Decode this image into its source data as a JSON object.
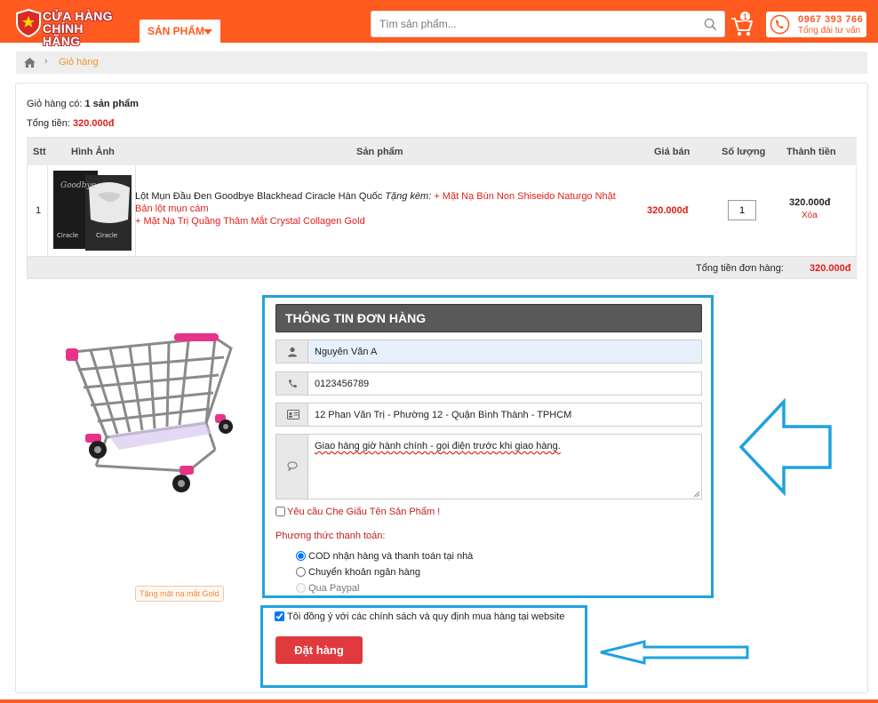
{
  "header": {
    "logo_line1": "CỬA HÀNG",
    "logo_line2": "CHÍNH HÃNG",
    "menu_label": "SẢN PHẨM",
    "search_placeholder": "Tìm sản phẩm...",
    "cart_count": "1",
    "hotline_number": "0967 393 766",
    "hotline_label": "Tổng đài tư vấn"
  },
  "breadcrumb": {
    "current": "Giỏ hàng"
  },
  "cart_summary": {
    "count_prefix": "Giỏ hàng có: ",
    "count_value": "1 sản phẩm",
    "total_prefix": "Tổng tiền: ",
    "total_value": "320.000đ"
  },
  "table": {
    "headers": [
      "Stt",
      "Hình Ảnh",
      "Sản phẩm",
      "Giá bán",
      "Số lượng",
      "Thành tiền"
    ],
    "rows": [
      {
        "stt": "1",
        "name": "Lột Mụn Đầu Đen Goodbye Blackhead Ciracle Hàn Quốc",
        "gift_prefix": "Tặng kèm:",
        "gift_1": "+ Mặt Nạ Bùn Non Shiseido Naturgo Nhật Bản lột mụn cám",
        "gift_2": "+ Mặt Nạ Trị Quầng Thâm Mắt Crystal Collagen Gold",
        "price": "320.000đ",
        "quantity": "1",
        "line_total": "320.000đ",
        "delete_label": "Xóa"
      }
    ],
    "footer_label": "Tổng tiền đơn hàng:",
    "footer_value": "320.000đ"
  },
  "illustration": {
    "gift_tag": "Tặng mặt nạ mắt Gold"
  },
  "order_form": {
    "title": "THÔNG TIN ĐƠN HÀNG",
    "name_value": "Nguyễn Văn A",
    "phone_value": "0123456789",
    "address_value": "12 Phan Văn Trị - Phường 12 - Quận Bình Thành - TPHCM",
    "note_value": "Giao hàng giờ hành chính - gọi điện trước khi giao hàng.",
    "hide_name_label": "Yêu cầu Che Giấu Tên Sản Phẩm !",
    "payment_label": "Phương thức thanh toán:",
    "payment_options": [
      "COD nhận hàng và thanh toán tại nhà",
      "Chuyển khoản ngân hàng",
      "Qua Paypal"
    ],
    "agree_label": "Tôi đồng ý với các chính sách và quy định mua hàng tại website",
    "submit_label": "Đặt hàng"
  },
  "colors": {
    "brand_orange": "#ff5a1f",
    "price_red": "#e0201b",
    "highlight_blue": "#1fa2e0",
    "button_red": "#e0393e"
  },
  "icons": [
    "shield-logo-icon",
    "caret-down-icon",
    "search-icon",
    "cart-icon",
    "phone-icon",
    "home-icon",
    "user-icon",
    "phone-handset-icon",
    "id-card-icon",
    "speech-bubble-icon",
    "arrow-left-icon"
  ]
}
